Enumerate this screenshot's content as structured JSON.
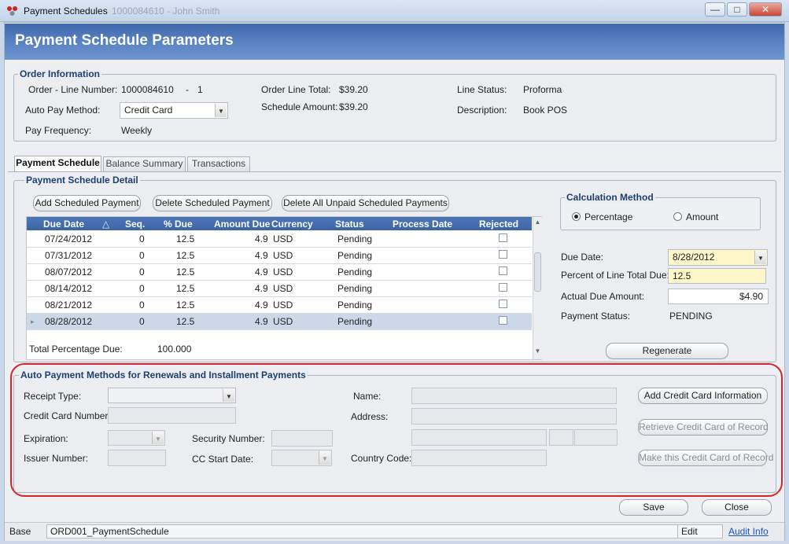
{
  "window": {
    "title": "Payment Schedules",
    "ghost_title": "1000084610 - John Smith",
    "minimize": "—",
    "maximize": "□",
    "close": "✕"
  },
  "banner": {
    "title": "Payment Schedule Parameters"
  },
  "order_info": {
    "title": "Order Information",
    "order_line_label": "Order - Line Number:",
    "order_number": "1000084610",
    "dash": "-",
    "line_number": "1",
    "auto_pay_label": "Auto Pay Method:",
    "auto_pay_value": "Credit Card",
    "pay_freq_label": "Pay Frequency:",
    "pay_freq_value": "Weekly",
    "line_total_label": "Order Line Total:",
    "line_total_value": "$39.20",
    "schedule_amount_label": "Schedule Amount:",
    "schedule_amount_value": "$39.20",
    "line_status_label": "Line Status:",
    "line_status_value": "Proforma",
    "description_label": "Description:",
    "description_value": "Book POS"
  },
  "tabs": [
    {
      "label": "Payment Schedule",
      "active": true
    },
    {
      "label": "Balance Summary",
      "active": false
    },
    {
      "label": "Transactions",
      "active": false
    }
  ],
  "detail": {
    "title": "Payment Schedule Detail",
    "add_button": "Add Scheduled Payment",
    "delete_button": "Delete Scheduled Payment",
    "delete_all_button": "Delete All Unpaid Scheduled Payments",
    "columns": [
      "Due Date",
      "Seq.",
      "% Due",
      "Amount Due",
      "Currency",
      "Status",
      "Process Date",
      "Rejected"
    ],
    "sort_indicator": "△",
    "rows": [
      {
        "due_date": "07/24/2012",
        "seq": "0",
        "pct": "12.5",
        "amount": "4.9",
        "currency": "USD",
        "status": "Pending",
        "selected": false
      },
      {
        "due_date": "07/31/2012",
        "seq": "0",
        "pct": "12.5",
        "amount": "4.9",
        "currency": "USD",
        "status": "Pending",
        "selected": false
      },
      {
        "due_date": "08/07/2012",
        "seq": "0",
        "pct": "12.5",
        "amount": "4.9",
        "currency": "USD",
        "status": "Pending",
        "selected": false
      },
      {
        "due_date": "08/14/2012",
        "seq": "0",
        "pct": "12.5",
        "amount": "4.9",
        "currency": "USD",
        "status": "Pending",
        "selected": false
      },
      {
        "due_date": "08/21/2012",
        "seq": "0",
        "pct": "12.5",
        "amount": "4.9",
        "currency": "USD",
        "status": "Pending",
        "selected": false
      },
      {
        "due_date": "08/28/2012",
        "seq": "0",
        "pct": "12.5",
        "amount": "4.9",
        "currency": "USD",
        "status": "Pending",
        "selected": true
      }
    ],
    "total_pct_label": "Total Percentage Due:",
    "total_pct_value": "100.000"
  },
  "calc": {
    "title": "Calculation Method",
    "percentage_label": "Percentage",
    "amount_label": "Amount",
    "selected": "Percentage",
    "due_date_label": "Due Date:",
    "due_date_value": "8/28/2012",
    "percent_label": "Percent of Line Total Due:",
    "percent_value": "12.5",
    "actual_label": "Actual Due Amount:",
    "actual_value": "$4.90",
    "status_label": "Payment Status:",
    "status_value": "PENDING",
    "regenerate_button": "Regenerate"
  },
  "auto_payment": {
    "title": "Auto Payment Methods for Renewals and Installment Payments",
    "receipt_type_label": "Receipt Type:",
    "cc_number_label": "Credit Card Number:",
    "expiration_label": "Expiration:",
    "issuer_label": "Issuer Number:",
    "security_label": "Security Number:",
    "cc_start_label": "CC Start Date:",
    "name_label": "Name:",
    "address_label": "Address:",
    "country_label": "Country Code:",
    "add_cc_button": "Add Credit Card Information",
    "retrieve_button": "Retrieve Credit Card of Record",
    "make_record_button": "Make this Credit Card of Record"
  },
  "footer": {
    "save_button": "Save",
    "close_button": "Close"
  },
  "statusbar": {
    "base_label": "Base",
    "form_id": "ORD001_PaymentSchedule",
    "mode": "Edit",
    "audit_link": "Audit Info"
  },
  "colors": {
    "banner": "#4a74b8",
    "grid_header": "#4670b2",
    "highlight": "#d8232a",
    "field_yellow": "#fdf6c8"
  }
}
